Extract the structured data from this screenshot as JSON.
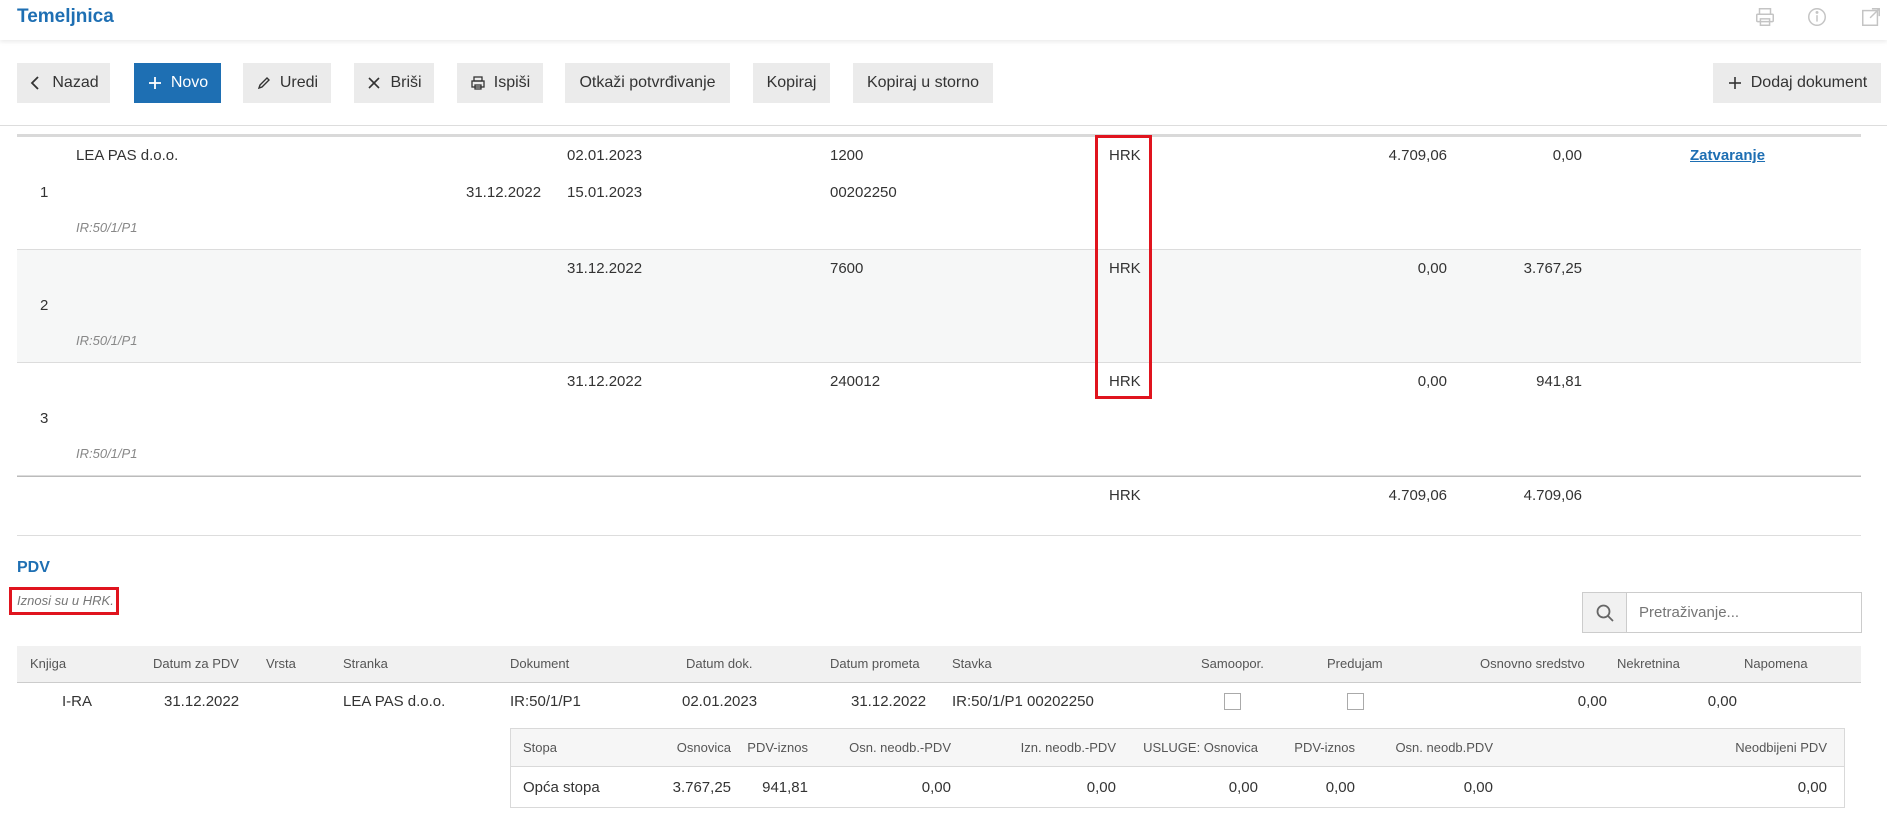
{
  "header": {
    "title": "Temeljnica",
    "icons": [
      "print-icon",
      "info-icon",
      "external-link-icon"
    ]
  },
  "toolbar": {
    "back": "Nazad",
    "new": "Novo",
    "edit": "Uredi",
    "delete": "Briši",
    "print": "Ispiši",
    "cancel_confirm": "Otkaži potvrđivanje",
    "copy": "Kopiraj",
    "copy_storno": "Kopiraj u storno",
    "add_document": "Dodaj dokument"
  },
  "ledger": {
    "rows": [
      {
        "num": "1",
        "party": "LEA PAS d.o.o.",
        "date_a": "31.12.2022",
        "date_b": "02.01.2023",
        "date_c": "15.01.2023",
        "account": "1200",
        "account2": "00202250",
        "currency": "HRK",
        "debit": "4.709,06",
        "credit": "0,00",
        "ref": "IR:50/1/P1",
        "link": "Zatvaranje"
      },
      {
        "num": "2",
        "party": "",
        "date_a": "",
        "date_b": "31.12.2022",
        "date_c": "",
        "account": "7600",
        "account2": "",
        "currency": "HRK",
        "debit": "0,00",
        "credit": "3.767,25",
        "ref": "IR:50/1/P1",
        "link": ""
      },
      {
        "num": "3",
        "party": "",
        "date_a": "",
        "date_b": "31.12.2022",
        "date_c": "",
        "account": "240012",
        "account2": "",
        "currency": "HRK",
        "debit": "0,00",
        "credit": "941,81",
        "ref": "IR:50/1/P1",
        "link": ""
      }
    ],
    "total": {
      "currency": "HRK",
      "debit": "4.709,06",
      "credit": "4.709,06"
    }
  },
  "pdv": {
    "title": "PDV",
    "note": "Iznosi su u HRK.",
    "search_placeholder": "Pretraživanje...",
    "columns": [
      "Knjiga",
      "Datum za PDV",
      "Vrsta",
      "Stranka",
      "Dokument",
      "Datum dok.",
      "Datum prometa",
      "Stavka",
      "Samoopor.",
      "Predujam",
      "Osnovno sredstvo",
      "Nekretnina",
      "Napomena"
    ],
    "row": {
      "knjiga": "I-RA",
      "datum_pdv": "31.12.2022",
      "vrsta": "",
      "stranka": "LEA PAS d.o.o.",
      "dokument": "IR:50/1/P1",
      "datum_dok": "02.01.2023",
      "datum_prometa": "31.12.2022",
      "stavka": "IR:50/1/P1 00202250",
      "osnovno_sredstvo": "0,00",
      "nekretnina": "0,00",
      "napomena": ""
    },
    "sub_columns": [
      "Stopa",
      "Osnovica",
      "PDV-iznos",
      "Osn. neodb.-PDV",
      "Izn. neodb.-PDV",
      "USLUGE: Osnovica",
      "PDV-iznos",
      "Osn. neodb.PDV",
      "Neodbijeni PDV"
    ],
    "sub_row": [
      "Opća stopa",
      "3.767,25",
      "941,81",
      "0,00",
      "0,00",
      "0,00",
      "0,00",
      "0,00",
      "0,00"
    ]
  },
  "colors": {
    "accent": "#1e6fb3",
    "highlight": "#e0141e"
  }
}
